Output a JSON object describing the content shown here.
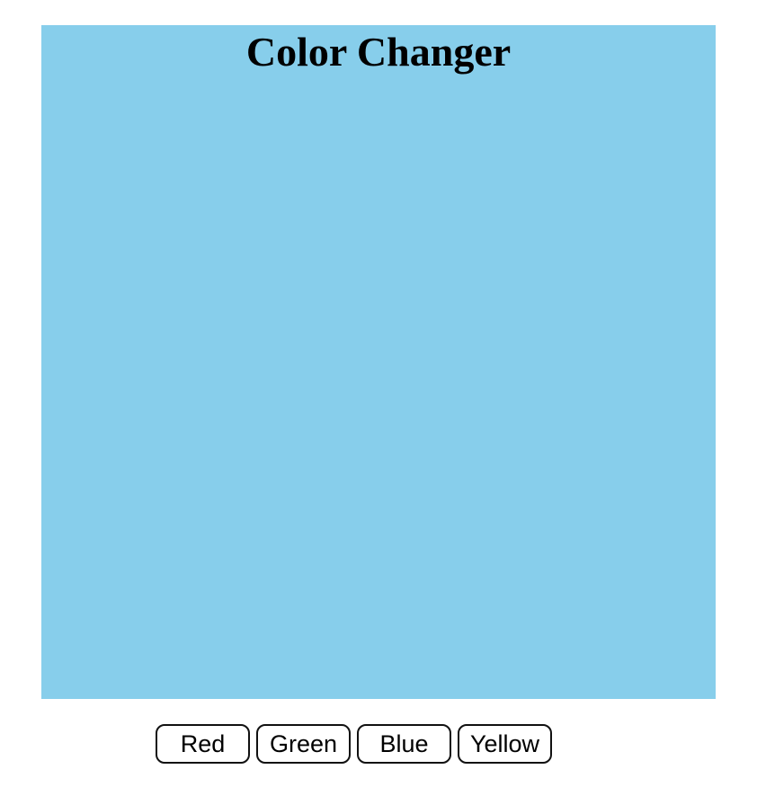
{
  "app": {
    "title": "Color Changer",
    "display_color": "#87ceeb"
  },
  "buttons": [
    {
      "label": "Red",
      "color": "red"
    },
    {
      "label": "Green",
      "color": "green"
    },
    {
      "label": "Blue",
      "color": "blue"
    },
    {
      "label": "Yellow",
      "color": "yellow"
    }
  ]
}
